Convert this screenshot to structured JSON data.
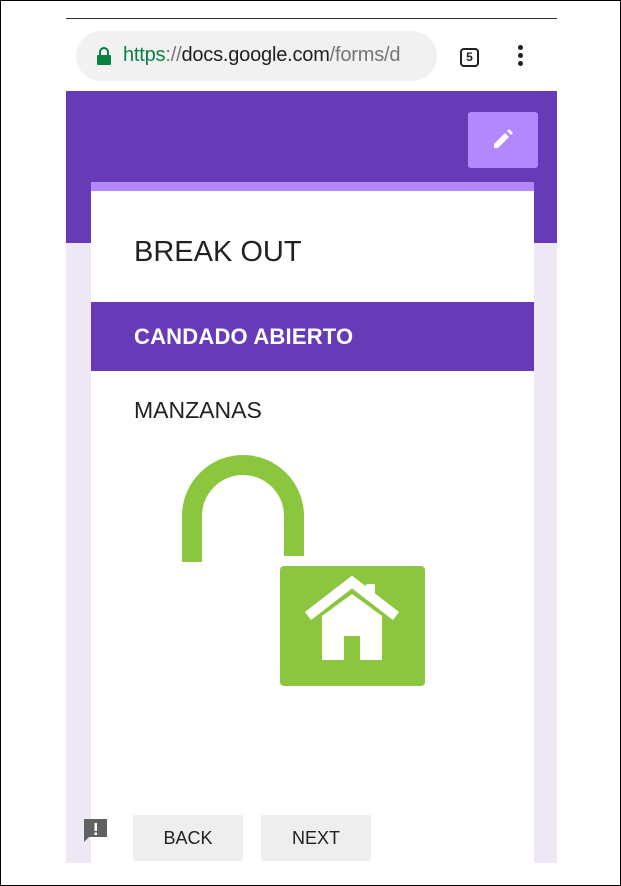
{
  "browser": {
    "url_scheme": "https",
    "url_separator": "://",
    "url_host": "docs.google.com",
    "url_path": "/forms/d",
    "tab_count": "5"
  },
  "colors": {
    "theme_primary": "#673ab7",
    "theme_accent": "#b388ff",
    "page_background": "#ede7f6",
    "lock_green": "#0b8043",
    "image_green": "#8cc63f"
  },
  "form": {
    "title": "BREAK OUT",
    "section_title": "CANDADO ABIERTO",
    "question": "MANZANAS",
    "image_icon": "open-padlock-with-house-icon"
  },
  "buttons": {
    "back": "BACK",
    "next": "NEXT"
  },
  "icons": {
    "lock": "lock-icon",
    "edit": "pencil-icon",
    "menu": "more-vert-icon",
    "feedback": "feedback-icon"
  }
}
